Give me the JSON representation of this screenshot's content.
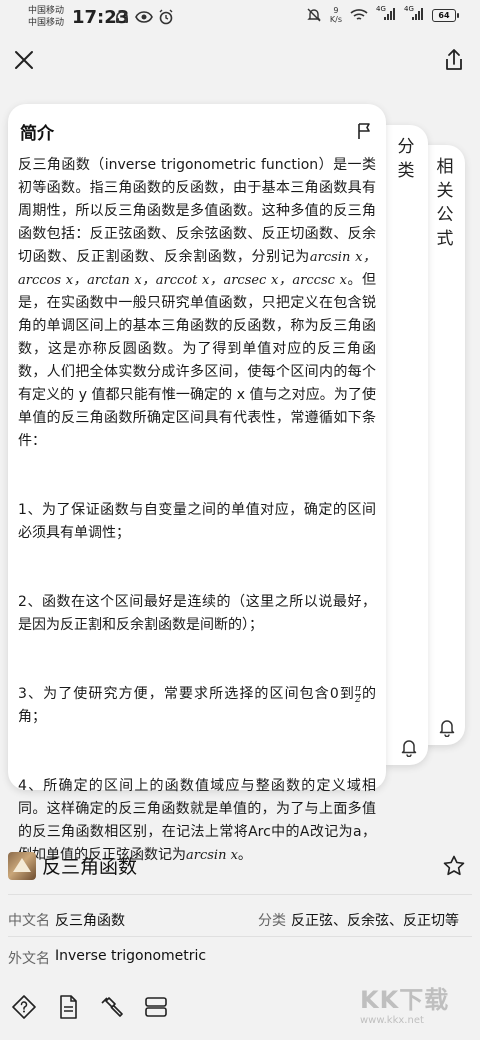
{
  "status_bar": {
    "carrier_1": "中国移动",
    "carrier_2": "中国移动",
    "time": "17:23",
    "net_speed_value": "9",
    "net_speed_unit": "K/s",
    "signal_1": "4G",
    "signal_2": "4G",
    "battery": "64"
  },
  "cards": {
    "main": {
      "title": "简介",
      "paragraphs": {
        "p1_a": "反三角函数（inverse trigonometric function）是一类初等函数。指三角函数的反函数，由于基本三角函数具有周期性，所以反三角函数是多值函数。这种多值的反三角函数包括：反正弦函数、反余弦函数、反正切函数、反余切函数、反正割函数、反余割函数，分别记为",
        "p1_math": "arcsin x，arccos x，arctan x，arccot x，arcsec x，arccsc x",
        "p1_b": "。但是，在实函数中一般只研究单值函数，只把定义在包含锐角的单调区间上的基本三角函数的反函数，称为反三角函数，这是亦称反圆函数。为了得到单值对应的反三角函数，人们把全体实数分成许多区间，使每个区间内的每个有定义的 y 值都只能有惟一确定的 x 值与之对应。为了使单值的反三角函数所确定区间具有代表性，常遵循如下条件：",
        "p2": "1、为了保证函数与自变量之间的单值对应，确定的区间必须具有单调性；",
        "p3": "2、函数在这个区间最好是连续的（这里之所以说最好，是因为反正割和反余割函数是间断的）；",
        "p4_a": "3、为了使研究方便，常要求所选择的区间包含0到",
        "p4_frac_num": "π",
        "p4_frac_den": "2",
        "p4_b": "的角；",
        "p5_a": "4、所确定的区间上的函数值域应与整函数的定义域相同。这样确定的反三角函数就是单值的，为了与上面多值的反三角函数相区别，在记法上常将Arc中的A改记为a，例如单值的反正弦函数记为",
        "p5_math": "arcsin x",
        "p5_b": "。"
      }
    },
    "back1": {
      "title": "分类"
    },
    "back2": {
      "title": "相关公式"
    }
  },
  "entry": {
    "title": "反三角函数",
    "chinese_name_label": "中文名",
    "chinese_name_value": "反三角函数",
    "category_label": "分类",
    "category_value": "反正弦、反余弦、反正切等",
    "foreign_name_label": "外文名",
    "foreign_name_value": "Inverse trigonometric"
  },
  "watermark": {
    "text": "KK下载",
    "url": "www.kkx.net"
  }
}
